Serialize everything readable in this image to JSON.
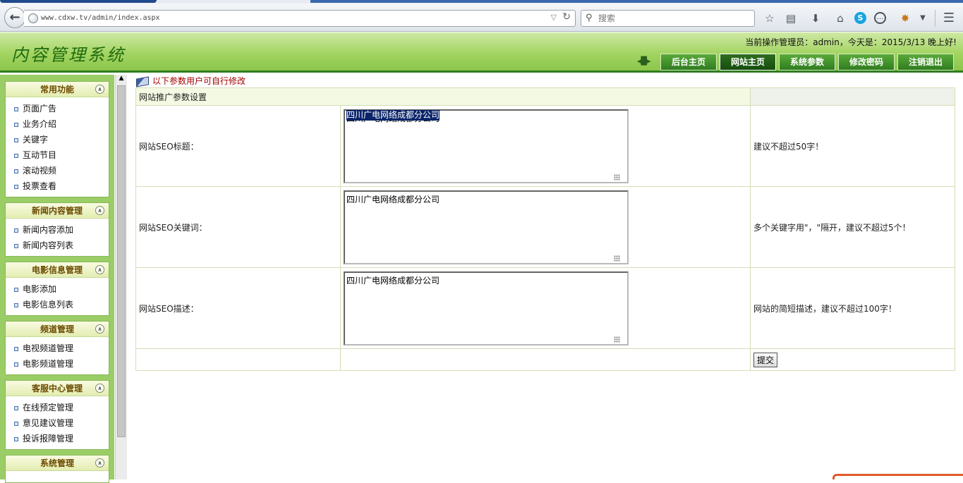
{
  "browser": {
    "url": "www.cdxw.tv/admin/index.aspx",
    "search_placeholder": "搜索"
  },
  "header": {
    "title": "内容管理系统",
    "admin_info": "当前操作管理员：admin，今天是：2015/3/13 晚上好!",
    "nav": [
      "后台主页",
      "网站主页",
      "系统参数",
      "修改密码",
      "注销退出"
    ],
    "active_nav": "网站主页"
  },
  "sidebar": {
    "panels": [
      {
        "title": "常用功能",
        "items": [
          "页面广告",
          "业务介绍",
          "关键字",
          "互动节目",
          "滚动视频",
          "投票查看"
        ]
      },
      {
        "title": "新闻内容管理",
        "items": [
          "新闻内容添加",
          "新闻内容列表"
        ]
      },
      {
        "title": "电影信息管理",
        "items": [
          "电影添加",
          "电影信息列表"
        ]
      },
      {
        "title": "频道管理",
        "items": [
          "电视频道管理",
          "电影频道管理"
        ]
      },
      {
        "title": "客服中心管理",
        "items": [
          "在线预定管理",
          "意见建议管理",
          "投诉报障管理"
        ]
      },
      {
        "title": "系统管理",
        "items": []
      }
    ]
  },
  "main": {
    "notice": "以下参数用户可自行修改",
    "section_title": "网站推广参数设置",
    "fields": [
      {
        "label": "网站SEO标题：",
        "value": "四川广电网络成都分公司",
        "hint": "建议不超过50字！"
      },
      {
        "label": "网站SEO关键词：",
        "value": "四川广电网络成都分公司",
        "hint": "多个关键字用\"，\"隔开，建议不超过5个！"
      },
      {
        "label": "网站SEO描述：",
        "value": "四川广电网络成都分公司",
        "hint": "网站的简短描述，建议不超过100字！"
      }
    ],
    "submit_label": "提交"
  }
}
